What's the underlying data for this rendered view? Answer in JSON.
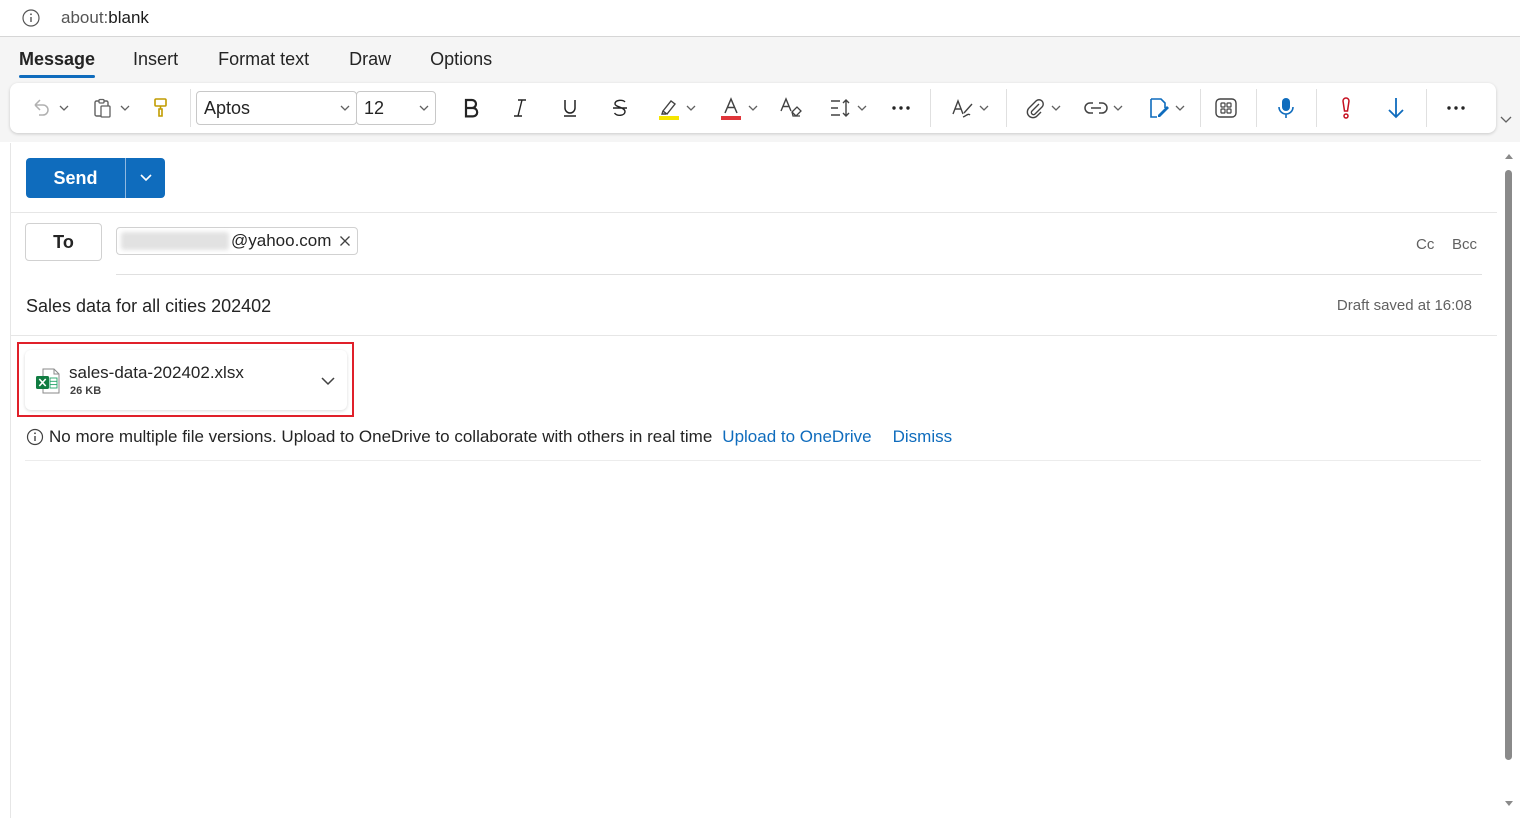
{
  "address_bar": {
    "prefix": "about:",
    "host": "blank"
  },
  "tabs": [
    {
      "label": "Message",
      "active": true
    },
    {
      "label": "Insert",
      "active": false
    },
    {
      "label": "Format text",
      "active": false
    },
    {
      "label": "Draw",
      "active": false
    },
    {
      "label": "Options",
      "active": false
    }
  ],
  "ribbon": {
    "font_name": "Aptos",
    "font_size": "12",
    "highlight_color": "#f5e500",
    "font_color": "#e0353a",
    "accent": "#0f6cbd",
    "importance_color": "#c50f1f"
  },
  "compose": {
    "send_label": "Send",
    "to_label": "To",
    "recipient_domain": "@yahoo.com",
    "cc_label": "Cc",
    "bcc_label": "Bcc",
    "subject": "Sales data for all cities 202402",
    "draft_status": "Draft saved at 16:08"
  },
  "attachment": {
    "file_name": "sales-data-202402.xlsx",
    "file_size": "26 KB",
    "highlight_color": "#e0202a"
  },
  "notice": {
    "text": "No more multiple file versions. Upload to OneDrive to collaborate with others in real time",
    "upload_link": "Upload to OneDrive",
    "dismiss_link": "Dismiss"
  }
}
